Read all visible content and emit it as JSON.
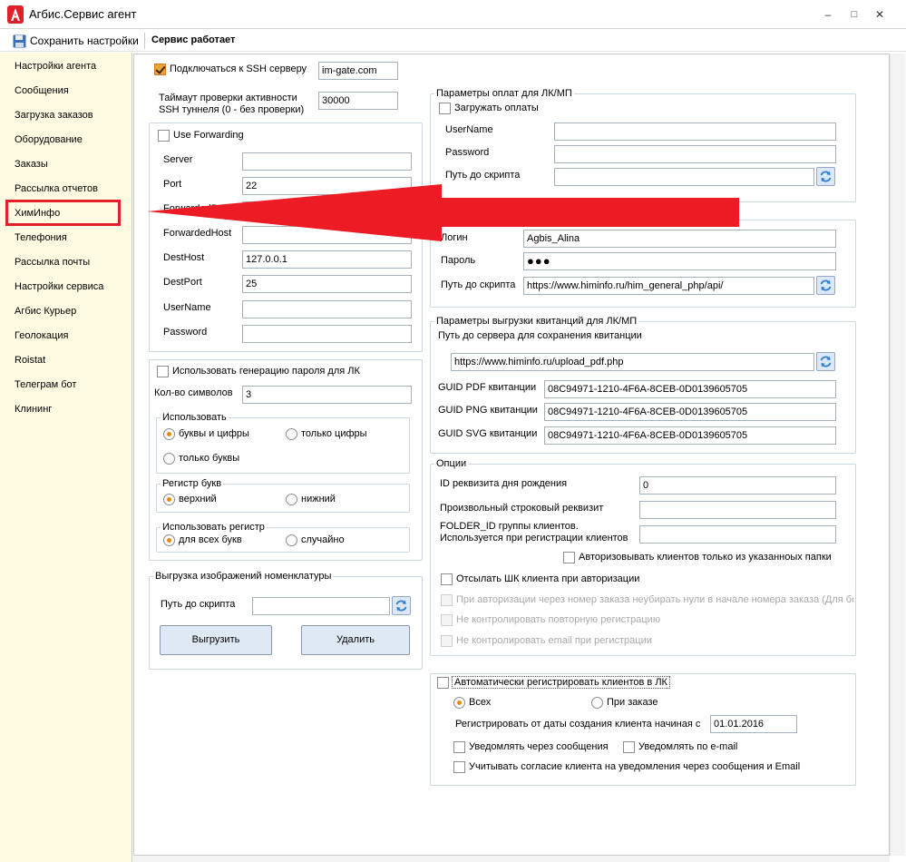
{
  "window": {
    "title": "Агбис.Сервис агент",
    "minimize": "–",
    "maximize": "□",
    "close": "✕"
  },
  "toolbar": {
    "save_label": "Сохранить настройки",
    "status": "Сервис работает"
  },
  "colors": {
    "accent": "#f3a13a",
    "highlight": "#e3202a",
    "arrow": "#ed1c24",
    "sidebar_bg": "#fffbe3"
  },
  "sidebar": {
    "items": [
      {
        "label": "Настройки агента"
      },
      {
        "label": "Сообщения"
      },
      {
        "label": "Загрузка заказов"
      },
      {
        "label": "Оборудование"
      },
      {
        "label": "Заказы"
      },
      {
        "label": "Рассылка отчетов"
      },
      {
        "label": "ХимИнфо",
        "selected": true
      },
      {
        "label": "Телефония"
      },
      {
        "label": "Рассылка почты"
      },
      {
        "label": "Настройки сервиса"
      },
      {
        "label": "Агбис Курьер"
      },
      {
        "label": "Геолокация"
      },
      {
        "label": "Roistat"
      },
      {
        "label": "Телеграм бот"
      },
      {
        "label": "Клининг"
      }
    ]
  },
  "ssh": {
    "connect_label": "Подключаться к SSH серверу",
    "connect_checked": true,
    "host": "im-gate.com",
    "timeout_label_1": "Таймаут проверки активности",
    "timeout_label_2": "SSH туннеля (0 - без проверки)",
    "timeout": "30000"
  },
  "forwarding": {
    "use_label": "Use Forwarding",
    "use_checked": false,
    "server_label": "Server",
    "server": "",
    "port_label": "Port",
    "port": "22",
    "forwarded_port_label": "ForwardedPort",
    "forwarded_port": "",
    "forwarded_host_label": "ForwardedHost",
    "forwarded_host": "",
    "dest_host_label": "DestHost",
    "dest_host": "127.0.0.1",
    "dest_port_label": "DestPort",
    "dest_port": "25",
    "username_label": "UserName",
    "username": "",
    "password_label": "Password",
    "password": ""
  },
  "password_gen": {
    "use_label": "Использовать генерацию пароля для ЛК",
    "use_checked": false,
    "count_label": "Кол-во символов",
    "count": "3",
    "use_group": "Использовать",
    "letters_digits": "буквы и цифры",
    "digits_only": "только цифры",
    "letters_only": "только буквы",
    "case_group": "Регистр букв",
    "upper": "верхний",
    "lower": "нижний",
    "apply_group": "Использовать регистр",
    "all_letters": "для всех букв",
    "random": "случайно"
  },
  "images": {
    "group": "Выгрузка изображений номенклатуры",
    "script_label": "Путь до скрипта",
    "script": "",
    "upload_btn": "Выгрузить",
    "delete_btn": "Удалить"
  },
  "payments": {
    "group": "Параметры оплат для ЛК/МП",
    "load_label": "Загружать оплаты",
    "load_checked": false,
    "username_label": "UserName",
    "username": "",
    "password_label": "Password",
    "password": "",
    "script_label": "Путь до скрипта",
    "script": ""
  },
  "himinfo": {
    "login_label": "Логин",
    "login": "Agbis_Alina",
    "password_label": "Пароль",
    "password": "●●●",
    "script_label": "Путь до скрипта",
    "script": "https://www.himinfo.ru/him_general_php/api/"
  },
  "receipts": {
    "group": "Параметры выгрузки квитанций для ЛК/МП",
    "server_label": "Путь до сервера для сохранения квитанции",
    "server": "https://www.himinfo.ru/upload_pdf.php",
    "pdf_label": "GUID PDF квитанции",
    "pdf": "08C94971-1210-4F6A-8CEB-0D0139605705",
    "png_label": "GUID PNG квитанции",
    "png": "08C94971-1210-4F6A-8CEB-0D0139605705",
    "svg_label": "GUID SVG квитанции",
    "svg": "08C94971-1210-4F6A-8CEB-0D0139605705"
  },
  "options": {
    "group": "Опции",
    "birthday_label": "ID реквизита дня рождения",
    "birthday": "0",
    "string_label": "Произвольный строковый реквизит",
    "string": "",
    "folder_label_1": "FOLDER_ID группы клиентов.",
    "folder_label_2": "Используется при регистрации клиентов",
    "folder": "",
    "authorize_folder_label": "Авторизовывать клиентов только из указанноых папки",
    "send_barcode_label": "Отсылать ШК клиента при авторизации",
    "keep_zeros_label": "При авторизации через номер заказа неубирать нули в начале номера заказа (Для бо",
    "no_repeat_label": "Не контролировать повторную регистрацию",
    "no_email_label": "Не контролировать email при регистрации"
  },
  "autoreg": {
    "label": "Автоматически регистрировать клиентов в ЛК",
    "all": "Всех",
    "on_order": "При заказе",
    "date_label": "Регистрировать от даты создания клиента начиная с",
    "date": "01.01.2016",
    "notify_msg": "Уведомлять через сообщения",
    "notify_email": "Уведомлять по e-mail",
    "consent": "Учитывать согласие клиента на уведомления через сообщения и Email"
  }
}
